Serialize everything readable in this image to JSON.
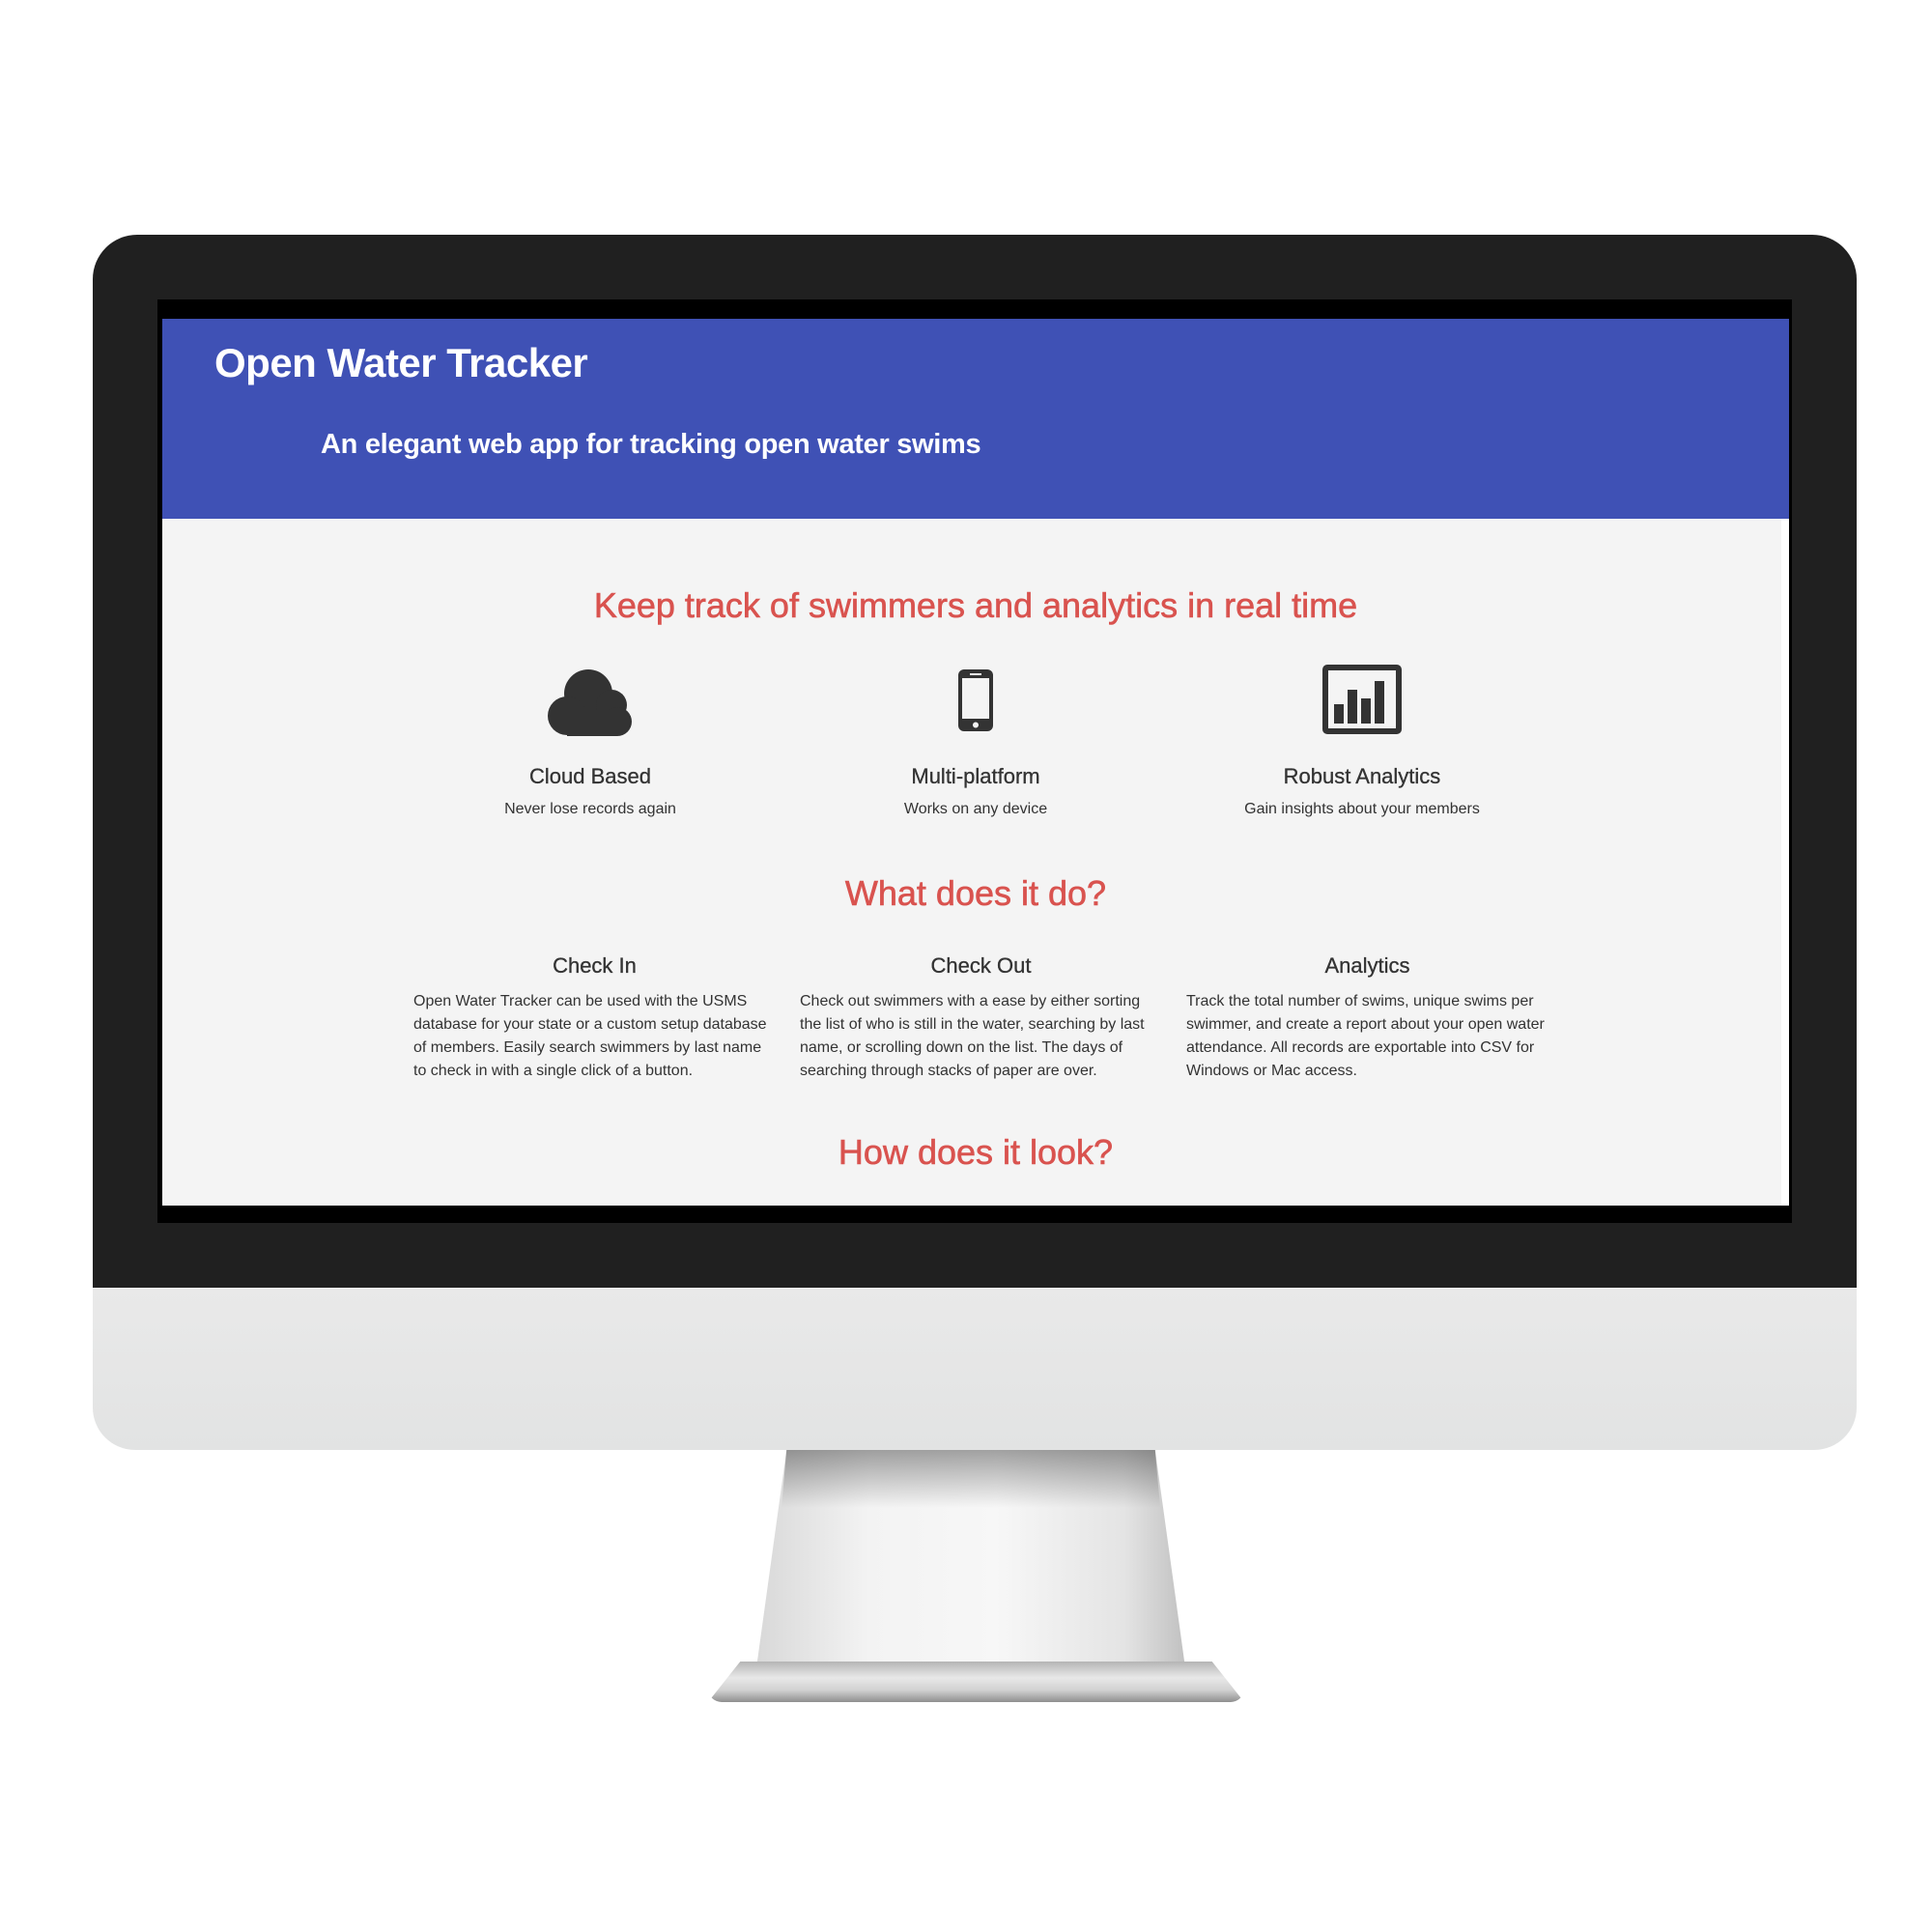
{
  "header": {
    "title": "Open Water Tracker",
    "tagline": "An elegant web app for tracking open water swims",
    "background_color": "#3f51b5"
  },
  "hero": {
    "heading": "Keep track of swimmers and analytics in real time",
    "heading_color": "#d9534f",
    "features": [
      {
        "icon": "cloud-icon",
        "title": "Cloud Based",
        "description": "Never lose records again"
      },
      {
        "icon": "phone-icon",
        "title": "Multi-platform",
        "description": "Works on any device"
      },
      {
        "icon": "bar-chart-icon",
        "title": "Robust Analytics",
        "description": "Gain insights about your members"
      }
    ]
  },
  "what": {
    "heading": "What does it do?",
    "columns": [
      {
        "title": "Check In",
        "text": "Open Water Tracker can be used with the USMS database for your state or a custom setup database of members. Easily search swimmers by last name to check in with a single click of a button."
      },
      {
        "title": "Check Out",
        "text": "Check out swimmers with a ease by either sorting the list of who is still in the water, searching by last name, or scrolling down on the list. The days of searching through stacks of paper are over."
      },
      {
        "title": "Analytics",
        "text": "Track the total number of swims, unique swims per swimmer, and create a report about your open water attendance. All records are exportable into CSV for Windows or Mac access."
      }
    ]
  },
  "look": {
    "heading": "How does it look?"
  }
}
